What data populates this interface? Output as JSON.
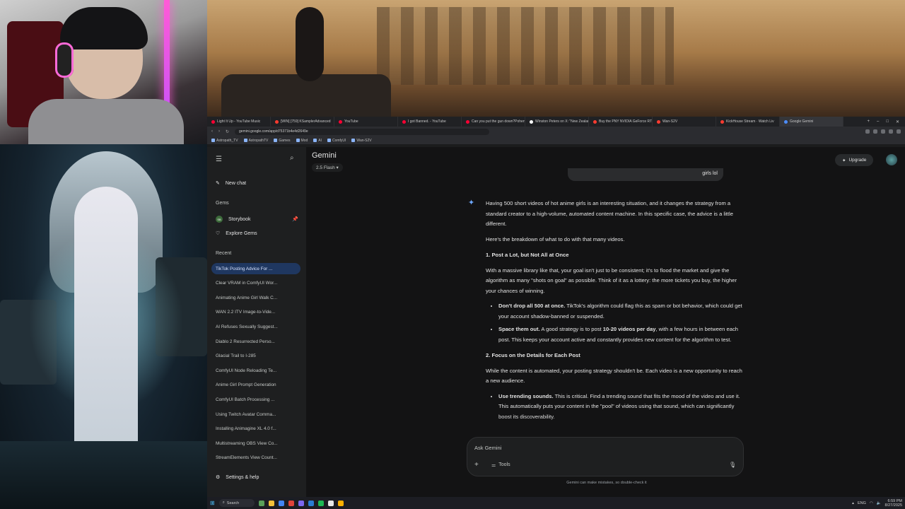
{
  "browser": {
    "tabs": [
      {
        "title": "Light It Up - YouTube Music",
        "kind": "yt"
      },
      {
        "title": "[WIN] [759] KSamplerAdvanced",
        "kind": "gen"
      },
      {
        "title": "YouTube",
        "kind": "yt"
      },
      {
        "title": "I got Banned. - YouTube",
        "kind": "yt"
      },
      {
        "title": "Can you put the gun down?Pohen",
        "kind": "yt"
      },
      {
        "title": "Winston Peters on X: \"New Zealan",
        "kind": "x"
      },
      {
        "title": "Buy the PNY NVIDIA GeForce RTX",
        "kind": "gen"
      },
      {
        "title": "Wan-S2V",
        "kind": "gen"
      },
      {
        "title": "KickHouse Stream · Watch Liv",
        "kind": "gen"
      },
      {
        "title": "Google Gemini",
        "kind": "gm",
        "active": true
      }
    ],
    "url": "gemini.google.com/app/d75371b4e4d2649e",
    "bookmarks": [
      "Astropath_TV",
      "AstropathTV",
      "Games",
      "Mod",
      "AI",
      "ComfyUI",
      "Wan-S2V"
    ]
  },
  "sidebar": {
    "new_chat": "New chat",
    "gems_label": "Gems",
    "gems": [
      {
        "label": "Storybook",
        "avatar": "SB"
      }
    ],
    "explore_gems": "Explore Gems",
    "recent_label": "Recent",
    "recent": [
      "TikTok Posting Advice For ...",
      "Clear VRAM in ComfyUI Wor...",
      "Animating Anime Girl Walk C...",
      "WAN 2.2 ITV Image-to-Vide...",
      "AI Refuses Sexually Suggest...",
      "Diablo 2 Resurrected Perso...",
      "Glacial Trail to I-285",
      "ComfyUI Node Reloading Te...",
      "Anime Girl Prompt Generation",
      "ComfyUI Batch Processing ...",
      "Using Twitch Avatar Comma...",
      "Installing Animagine XL 4.0 f...",
      "Multistreaming OBS View Co...",
      "StreamElements View Count..."
    ],
    "settings": "Settings & help"
  },
  "header": {
    "brand": "Gemini",
    "model": "2.5 Flash ▾",
    "upgrade": "Upgrade"
  },
  "chat": {
    "user_tail": "girls lol",
    "response": {
      "intro": "Having 500 short videos of hot anime girls is an interesting situation, and it changes the strategy from a standard creator to a high-volume, automated content machine. In this specific case, the advice is a little different.",
      "breakdown": "Here's the breakdown of what to do with that many videos.",
      "h1": "1. Post a Lot, but Not All at Once",
      "p1": "With a massive library like that, your goal isn't just to be consistent; it's to flood the market and give the algorithm as many \"shots on goal\" as possible. Think of it as a lottery: the more tickets you buy, the higher your chances of winning.",
      "b1_bold": "Don't drop all 500 at once.",
      "b1_text": " TikTok's algorithm could flag this as spam or bot behavior, which could get your account shadow-banned or suspended.",
      "b2_bold": "Space them out.",
      "b2_text_a": " A good strategy is to post ",
      "b2_bold2": "10-20 videos per day",
      "b2_text_b": ", with a few hours in between each post. This keeps your account active and constantly provides new content for the algorithm to test.",
      "h2": "2. Focus on the Details for Each Post",
      "p2": "While the content is automated, your posting strategy shouldn't be. Each video is a new opportunity to reach a new audience.",
      "b3_bold": "Use trending sounds.",
      "b3_text": " This is critical. Find a trending sound that fits the mood of the video and use it. This automatically puts your content in the \"pool\" of videos using that sound, which can significantly boost its discoverability."
    }
  },
  "composer": {
    "placeholder": "Ask Gemini",
    "tools": "Tools",
    "disclaimer": "Gemini can make mistakes, so double-check it"
  },
  "taskbar": {
    "search": "Search",
    "lang": "ENG",
    "time": "6:59 PM",
    "date": "8/27/2025"
  },
  "colors": {
    "accent": "#1f3760",
    "bg": "#131314",
    "sidebar": "#1e1f20"
  }
}
